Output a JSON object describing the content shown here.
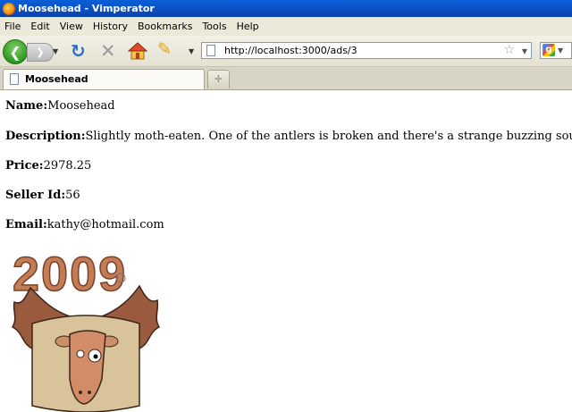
{
  "window": {
    "title": "Moosehead - Vimperator"
  },
  "menu": [
    "File",
    "Edit",
    "View",
    "History",
    "Bookmarks",
    "Tools",
    "Help"
  ],
  "toolbar": {
    "back_icon": "back-arrow-icon",
    "forward_icon": "forward-arrow-icon",
    "reload_icon": "reload-icon",
    "stop_icon": "stop-icon",
    "home_icon": "home-icon",
    "edit_icon": "pencil-icon",
    "url": "http://localhost:3000/ads/3"
  },
  "tabs": [
    {
      "label": "Moosehead",
      "active": true
    }
  ],
  "ad": {
    "name_label": "Name:",
    "name": "Moosehead",
    "description_label": "Description:",
    "description": "Slightly moth-eaten. One of the antlers is broken and there's a strange buzzing sound behind the eyes...",
    "price_label": "Price:",
    "price": "2978.25",
    "seller_label": "Seller Id:",
    "seller_id": "56",
    "email_label": "Email:",
    "email": "kathy@hotmail.com",
    "image_text": "2009"
  },
  "colors": {
    "titlebar": "#0b4fc0",
    "back_button": "#2f9a22",
    "brick": "#c47c56",
    "antler": "#9a5a3e"
  }
}
